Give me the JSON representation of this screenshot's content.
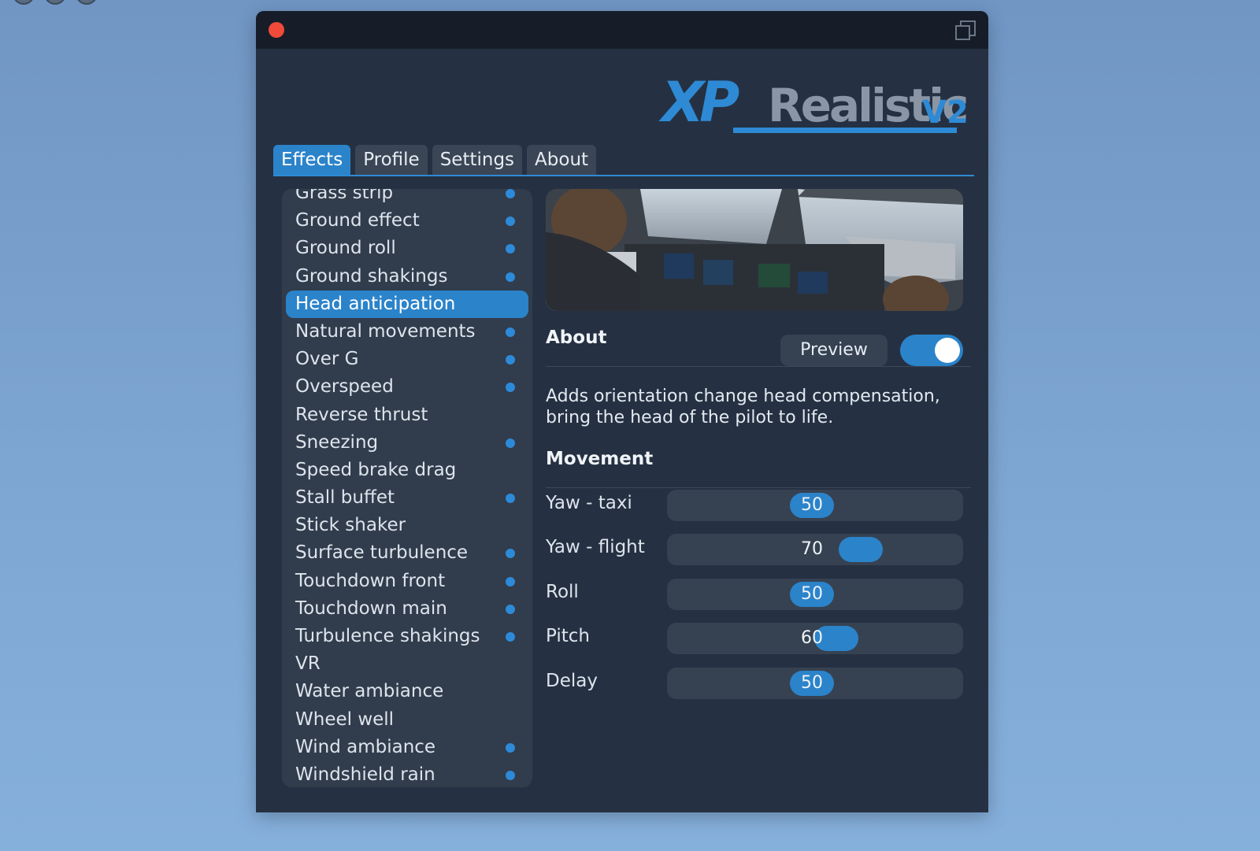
{
  "window": {
    "logo_text": "XPRealisticV2"
  },
  "tabs": [
    {
      "label": "Effects",
      "active": true
    },
    {
      "label": "Profile",
      "active": false
    },
    {
      "label": "Settings",
      "active": false
    },
    {
      "label": "About",
      "active": false
    }
  ],
  "effects": [
    {
      "label": "Grass strip",
      "enabled": true
    },
    {
      "label": "Ground effect",
      "enabled": true
    },
    {
      "label": "Ground roll",
      "enabled": true
    },
    {
      "label": "Ground shakings",
      "enabled": true
    },
    {
      "label": "Head anticipation",
      "enabled": true,
      "selected": true
    },
    {
      "label": "Natural movements",
      "enabled": true
    },
    {
      "label": "Over G",
      "enabled": true
    },
    {
      "label": "Overspeed",
      "enabled": true
    },
    {
      "label": "Reverse thrust",
      "enabled": false
    },
    {
      "label": "Sneezing",
      "enabled": true
    },
    {
      "label": "Speed brake drag",
      "enabled": false
    },
    {
      "label": "Stall buffet",
      "enabled": true
    },
    {
      "label": "Stick shaker",
      "enabled": false
    },
    {
      "label": "Surface turbulence",
      "enabled": true
    },
    {
      "label": "Touchdown front",
      "enabled": true
    },
    {
      "label": "Touchdown main",
      "enabled": true
    },
    {
      "label": "Turbulence shakings",
      "enabled": true
    },
    {
      "label": "VR",
      "enabled": false
    },
    {
      "label": "Water ambiance",
      "enabled": false
    },
    {
      "label": "Wheel well",
      "enabled": false
    },
    {
      "label": "Wind ambiance",
      "enabled": true
    },
    {
      "label": "Windshield rain",
      "enabled": true
    }
  ],
  "about": {
    "title": "About",
    "preview_label": "Preview",
    "toggle_on": true,
    "description": "Adds orientation change head compensation, bring the head of the pilot to life."
  },
  "movement": {
    "title": "Movement",
    "sliders": [
      {
        "label": "Yaw - taxi",
        "value": 50
      },
      {
        "label": "Yaw - flight",
        "value": 70
      },
      {
        "label": "Roll",
        "value": 50
      },
      {
        "label": "Pitch",
        "value": 60
      },
      {
        "label": "Delay",
        "value": 50
      }
    ]
  },
  "colors": {
    "accent": "#2b83ca",
    "window_bg": "#253142",
    "close": "#f04a3a"
  }
}
